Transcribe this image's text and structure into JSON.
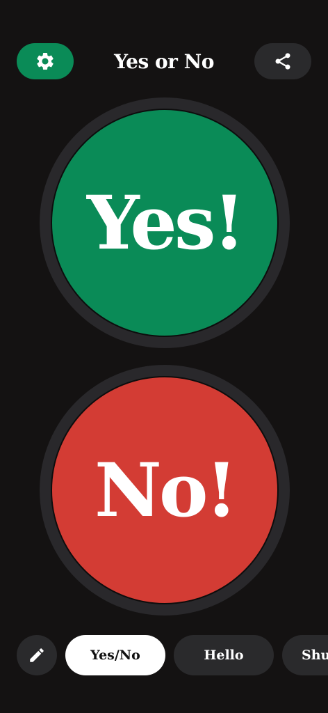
{
  "header": {
    "title": "Yes or No"
  },
  "buttons": {
    "yes_label": "Yes!",
    "no_label": "No!"
  },
  "chips": [
    {
      "label": "Yes/No",
      "active": true
    },
    {
      "label": "Hello",
      "active": false
    },
    {
      "label": "Shu",
      "active": false
    }
  ],
  "icons": {
    "settings": "gear-icon",
    "share": "share-icon",
    "edit": "pencil-icon"
  },
  "colors": {
    "background": "#141212",
    "yes": "#0a8b57",
    "no": "#d33c34",
    "surface": "#2a2a2c",
    "active_chip": "#ffffff"
  }
}
